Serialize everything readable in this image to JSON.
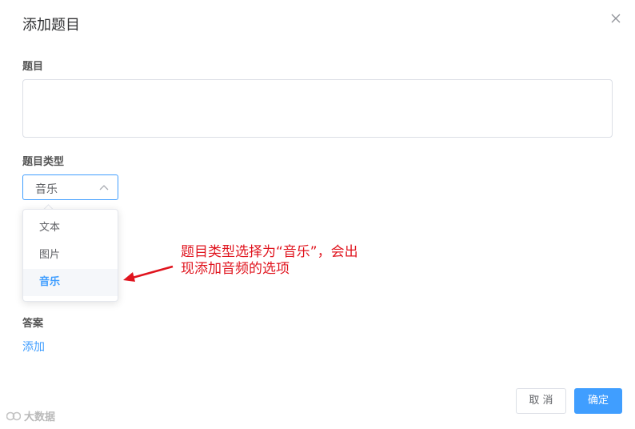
{
  "dialog": {
    "title": "添加题目",
    "close_icon": "close-icon"
  },
  "form": {
    "question_label": "题目",
    "question_value": "",
    "type_label": "题目类型",
    "type_selected": "音乐",
    "type_options": [
      "文本",
      "图片",
      "音乐"
    ],
    "answer_label": "答案",
    "answer_add_link": "添加"
  },
  "annotation": {
    "line1": "题目类型选择为“音乐”，会出",
    "line2": "现添加音频的选项",
    "color": "#e0141e"
  },
  "footer": {
    "cancel_label": "取 消",
    "confirm_label": "确定"
  },
  "watermark": {
    "text": "大数据"
  },
  "colors": {
    "accent": "#409eff",
    "annotation": "#e0141e"
  }
}
